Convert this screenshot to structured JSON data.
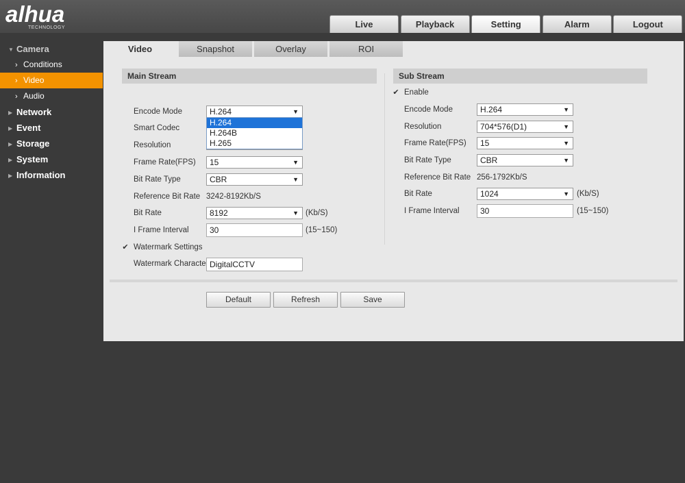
{
  "logo": {
    "brand": "alhua",
    "sub": "TECHNOLOGY"
  },
  "top_nav": [
    {
      "label": "Live",
      "active": false
    },
    {
      "label": "Playback",
      "active": false
    },
    {
      "label": "Setting",
      "active": true
    },
    {
      "label": "Alarm",
      "active": false
    },
    {
      "label": "Logout",
      "active": false
    }
  ],
  "sidebar": {
    "camera": "Camera",
    "camera_items": [
      "Conditions",
      "Video",
      "Audio"
    ],
    "sections": [
      "Network",
      "Event",
      "Storage",
      "System",
      "Information"
    ]
  },
  "sub_tabs": [
    "Video",
    "Snapshot",
    "Overlay",
    "ROI"
  ],
  "main_stream": {
    "title": "Main Stream",
    "labels": {
      "encode_mode": "Encode Mode",
      "smart_codec": "Smart Codec",
      "resolution": "Resolution",
      "frame_rate": "Frame Rate(FPS)",
      "bit_rate_type": "Bit Rate Type",
      "reference_bit_rate": "Reference Bit Rate",
      "bit_rate": "Bit Rate",
      "i_frame_interval": "I Frame Interval",
      "watermark_settings": "Watermark Settings",
      "watermark_character": "Watermark Character"
    },
    "values": {
      "encode_mode": "H.264",
      "encode_mode_options": [
        "H.264",
        "H.264B",
        "H.265"
      ],
      "frame_rate": "15",
      "bit_rate_type": "CBR",
      "reference_bit_rate": "3242-8192Kb/S",
      "bit_rate": "8192",
      "bit_rate_unit": "(Kb/S)",
      "i_frame_interval": "30",
      "i_frame_range": "(15~150)",
      "watermark_character": "DigitalCCTV"
    }
  },
  "sub_stream": {
    "title": "Sub Stream",
    "enable_label": "Enable",
    "labels": {
      "encode_mode": "Encode Mode",
      "resolution": "Resolution",
      "frame_rate": "Frame Rate(FPS)",
      "bit_rate_type": "Bit Rate Type",
      "reference_bit_rate": "Reference Bit Rate",
      "bit_rate": "Bit Rate",
      "i_frame_interval": "I Frame Interval"
    },
    "values": {
      "encode_mode": "H.264",
      "resolution": "704*576(D1)",
      "frame_rate": "15",
      "bit_rate_type": "CBR",
      "reference_bit_rate": "256-1792Kb/S",
      "bit_rate": "1024",
      "bit_rate_unit": "(Kb/S)",
      "i_frame_interval": "30",
      "i_frame_range": "(15~150)"
    }
  },
  "buttons": {
    "default": "Default",
    "refresh": "Refresh",
    "save": "Save"
  },
  "colors": {
    "accent": "#f39200",
    "highlight": "#1e73d8"
  }
}
